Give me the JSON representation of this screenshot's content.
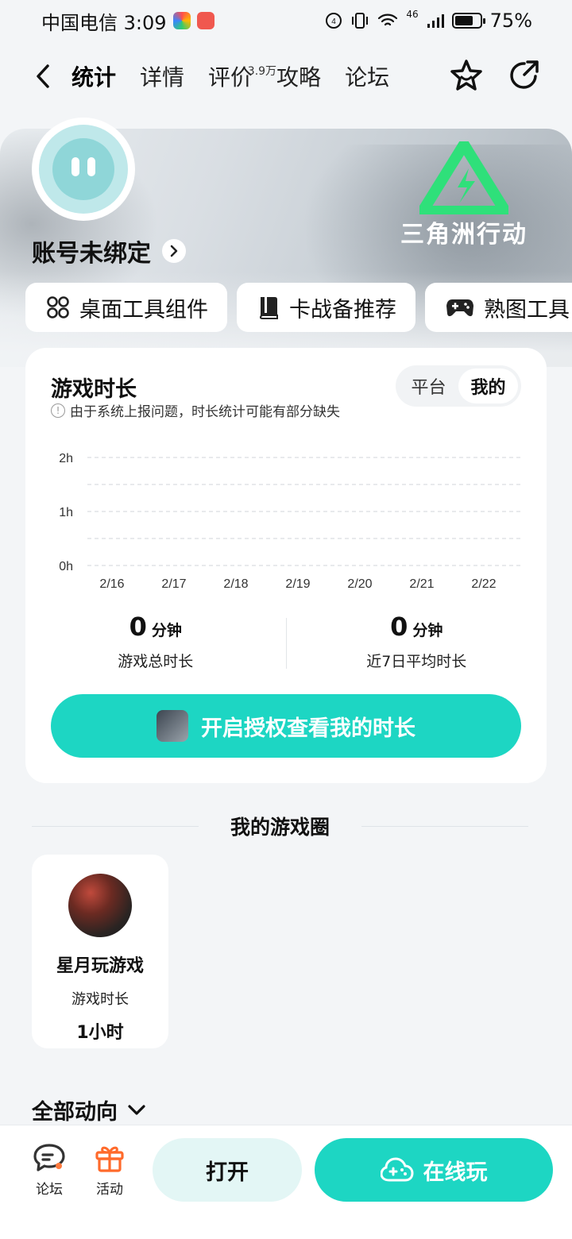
{
  "status_bar": {
    "carrier_time": "中国电信 3:09",
    "network": "46",
    "battery": "75%",
    "battery_level": 0.75
  },
  "nav": {
    "tabs": [
      {
        "label": "统计",
        "active": true
      },
      {
        "label": "详情"
      },
      {
        "label": "评价",
        "badge": "3.9万"
      },
      {
        "label": "攻略"
      },
      {
        "label": "论坛"
      }
    ],
    "icons": [
      "back-icon",
      "star-icon",
      "share-icon"
    ]
  },
  "hero": {
    "game_name": "三角洲行动",
    "account_label": "账号未绑定"
  },
  "tools": [
    {
      "label": "桌面工具组件",
      "icon": "widgets-icon"
    },
    {
      "label": "卡战备推荐",
      "icon": "book-icon"
    },
    {
      "label": "熟图工具",
      "icon": "gamepad-icon"
    }
  ],
  "playtime": {
    "title": "游戏时长",
    "note": "由于系统上报问题，时长统计可能有部分缺失",
    "segment": {
      "options": [
        "平台",
        "我的"
      ],
      "selected": "我的"
    },
    "summary": [
      {
        "value": "0",
        "unit": "分钟",
        "label": "游戏总时长"
      },
      {
        "value": "0",
        "unit": "分钟",
        "label": "近7日平均时长"
      }
    ],
    "auth_button": "开启授权查看我的时长"
  },
  "chart_data": {
    "type": "bar",
    "categories": [
      "2/16",
      "2/17",
      "2/18",
      "2/19",
      "2/20",
      "2/21",
      "2/22"
    ],
    "values": [
      0,
      0,
      0,
      0,
      0,
      0,
      0
    ],
    "ytick_labels": [
      "2h",
      "1h",
      "0h"
    ],
    "ylim": [
      0,
      2
    ],
    "grid": true,
    "title": "",
    "xlabel": "",
    "ylabel": ""
  },
  "circle": {
    "section_title": "我的游戏圈",
    "name": "星月玩游戏",
    "label": "游戏时长",
    "value": "1小时"
  },
  "feed": {
    "title": "全部动向"
  },
  "bottom": {
    "forum": "论坛",
    "activity": "活动",
    "open": "打开",
    "play_online": "在线玩"
  },
  "colors": {
    "accent": "#1dd6c3",
    "background": "#f3f5f7"
  }
}
